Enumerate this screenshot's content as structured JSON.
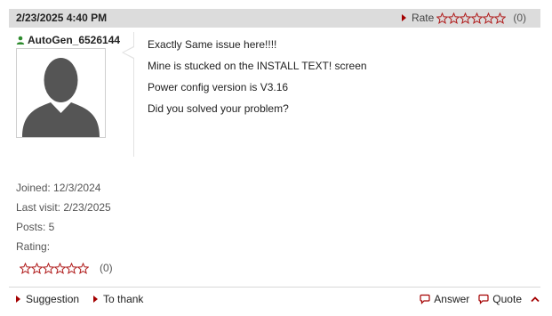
{
  "post": {
    "date": "2/23/2025 4:40 PM",
    "rate_label": "Rate",
    "rate_count": "(0)",
    "stars_filled": 0,
    "stars_total": 6
  },
  "author": {
    "name": "AutoGen_6526144",
    "icon": "user-icon",
    "avatar_icon": "default-avatar-icon"
  },
  "message": {
    "lines": [
      "Exactly Same issue here!!!!",
      "Mine is stucked on the INSTALL TEXT! screen",
      "Power config version is V3.16",
      "Did you solved your problem?"
    ]
  },
  "stats": {
    "joined": "Joined: 12/3/2024",
    "last_visit": "Last visit: 2/23/2025",
    "posts": "Posts: 5",
    "rating_label": "Rating:",
    "rating_count": "(0)"
  },
  "footer": {
    "suggestion": "Suggestion",
    "thank": "To thank",
    "answer": "Answer",
    "quote": "Quote"
  },
  "colors": {
    "accent": "#a40000",
    "header_bg": "#dcdcdc",
    "star_outline": "#b01c1c"
  }
}
